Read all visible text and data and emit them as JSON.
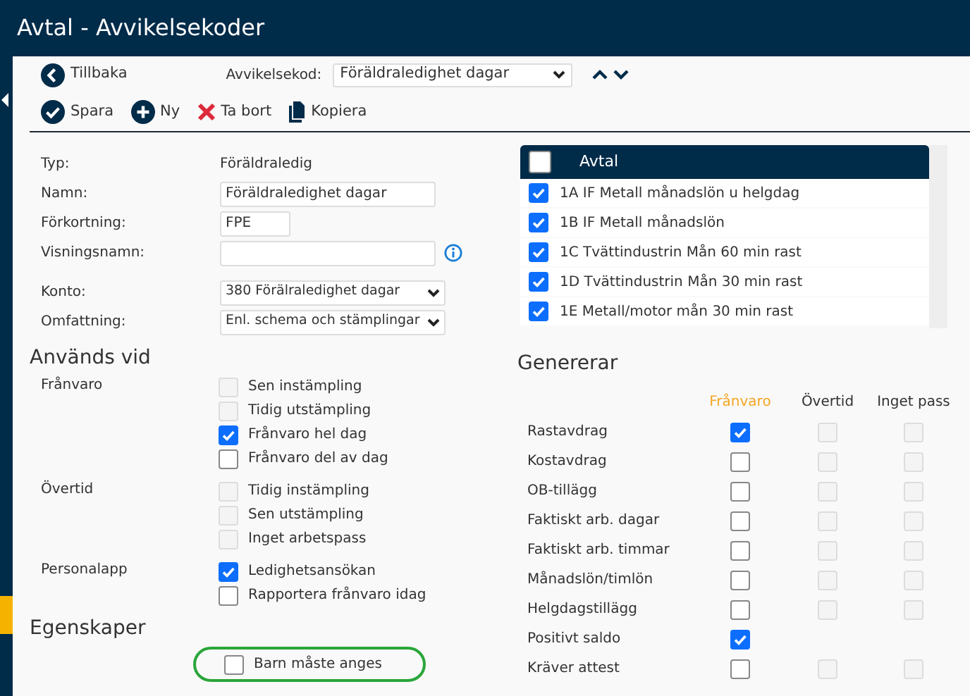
{
  "window": {
    "title": "Avtal - Avvikelsekoder"
  },
  "toolbar": {
    "back": "Tillbaka",
    "code_label": "Avvikelsekod:",
    "code_value": "Föräldraledighet dagar",
    "actions": [
      {
        "kind": "save",
        "label": "Spara"
      },
      {
        "kind": "new",
        "label": "Ny"
      },
      {
        "kind": "delete",
        "label": "Ta bort"
      },
      {
        "kind": "copy",
        "label": "Kopiera"
      }
    ]
  },
  "form": [
    {
      "kind": "text",
      "label": "Typ:",
      "value": "Föräldraledig"
    },
    {
      "kind": "input",
      "label": "Namn:",
      "value": "Föräldraledighet dagar"
    },
    {
      "kind": "short_input",
      "label": "Förkortning:",
      "value": "FPE"
    },
    {
      "kind": "input",
      "label": "Visningsnamn:",
      "info": true
    },
    {
      "kind": "select",
      "label": "Konto:",
      "value": "380 Förälraledighet dagar"
    },
    {
      "kind": "select",
      "label": "Omfattning:",
      "value": "Enl. schema och stämplingar"
    }
  ],
  "agreements": {
    "header": "Avtal",
    "all_checked": false,
    "items": [
      {
        "label": "1A IF Metall månadslön u helgdag",
        "checked": true
      },
      {
        "label": "1B IF Metall månadslön",
        "checked": true
      },
      {
        "label": "1C Tvättindustrin Mån 60 min rast",
        "checked": true
      },
      {
        "label": "1D Tvättindustrin Mån 30 min rast",
        "checked": true
      },
      {
        "label": "1E Metall/motor mån 30 min rast",
        "checked": true
      }
    ]
  },
  "used_in": {
    "title": "Används vid",
    "groups": [
      {
        "label": "Frånvaro",
        "options": [
          {
            "label": "Sen instämpling",
            "checked": false,
            "disabled": true
          },
          {
            "label": "Tidig utstämpling",
            "checked": false,
            "disabled": true
          },
          {
            "label": "Frånvaro hel dag",
            "checked": true,
            "disabled": false
          },
          {
            "label": "Frånvaro del av dag",
            "checked": false,
            "disabled": false
          }
        ]
      },
      {
        "label": "Övertid",
        "options": [
          {
            "label": "Tidig instämpling",
            "checked": false,
            "disabled": true
          },
          {
            "label": "Sen utstämpling",
            "checked": false,
            "disabled": true
          },
          {
            "label": "Inget arbetspass",
            "checked": false,
            "disabled": true
          }
        ]
      },
      {
        "label": "Personalapp",
        "options": [
          {
            "label": "Ledighetsansökan",
            "checked": true,
            "disabled": false
          },
          {
            "label": "Rapportera frånvaro idag",
            "checked": false,
            "disabled": false
          }
        ]
      }
    ]
  },
  "properties": {
    "title": "Egenskaper",
    "options": [
      {
        "label": "Barn måste anges",
        "checked": false,
        "highlighted": true
      }
    ]
  },
  "generates": {
    "title": "Genererar",
    "columns": [
      {
        "label": "Frånvaro",
        "selected": true
      },
      {
        "label": "Övertid",
        "selected": false
      },
      {
        "label": "Inget pass",
        "selected": false
      }
    ],
    "rows": [
      {
        "label": "Rastavdrag",
        "cells": [
          {
            "checked": true,
            "disabled": false
          },
          {
            "checked": false,
            "disabled": true
          },
          {
            "checked": false,
            "disabled": true
          }
        ]
      },
      {
        "label": "Kostavdrag",
        "cells": [
          {
            "checked": false,
            "disabled": false
          },
          {
            "checked": false,
            "disabled": true
          },
          {
            "checked": false,
            "disabled": true
          }
        ]
      },
      {
        "label": "OB-tillägg",
        "cells": [
          {
            "checked": false,
            "disabled": false
          },
          {
            "checked": false,
            "disabled": true
          },
          {
            "checked": false,
            "disabled": true
          }
        ]
      },
      {
        "label": "Faktiskt arb. dagar",
        "cells": [
          {
            "checked": false,
            "disabled": false
          },
          {
            "checked": false,
            "disabled": true
          },
          {
            "checked": false,
            "disabled": true
          }
        ]
      },
      {
        "label": "Faktiskt arb. timmar",
        "cells": [
          {
            "checked": false,
            "disabled": false
          },
          {
            "checked": false,
            "disabled": true
          },
          {
            "checked": false,
            "disabled": true
          }
        ]
      },
      {
        "label": "Månadslön/timlön",
        "cells": [
          {
            "checked": false,
            "disabled": false
          },
          {
            "checked": false,
            "disabled": true
          },
          {
            "checked": false,
            "disabled": true
          }
        ]
      },
      {
        "label": "Helgdagstillägg",
        "cells": [
          {
            "checked": false,
            "disabled": false
          },
          {
            "checked": false,
            "disabled": true
          },
          {
            "checked": false,
            "disabled": true
          }
        ]
      },
      {
        "label": "Positivt saldo",
        "cells": [
          {
            "checked": true,
            "disabled": false
          }
        ]
      },
      {
        "label": "Kräver attest",
        "cells": [
          {
            "checked": false,
            "disabled": false
          },
          {
            "checked": false,
            "disabled": true
          },
          {
            "checked": false,
            "disabled": true
          }
        ]
      }
    ]
  }
}
